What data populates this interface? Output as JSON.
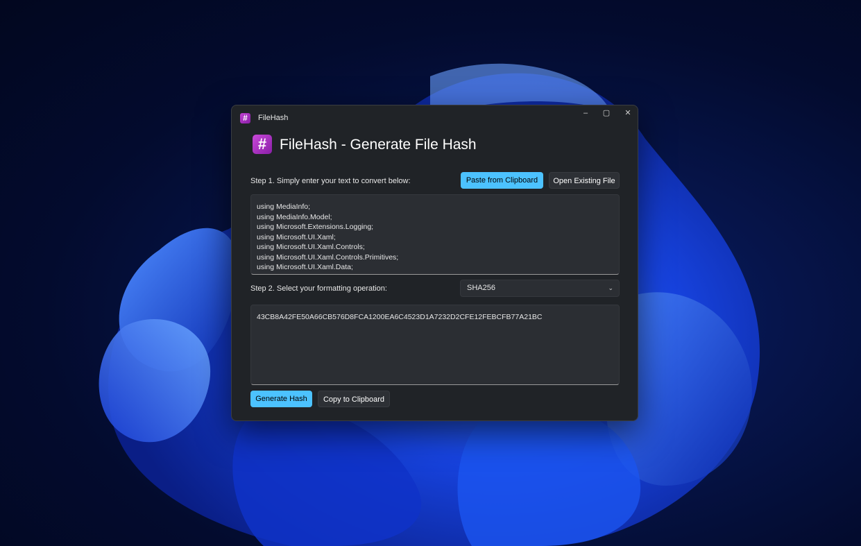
{
  "window": {
    "title": "FileHash",
    "controls": {
      "minimize": "–",
      "maximize": "▢",
      "close": "✕"
    }
  },
  "header": {
    "title": "FileHash - Generate File Hash",
    "icon_glyph": "#"
  },
  "step1": {
    "label": "Step 1. Simply enter your text to convert below:",
    "paste_button": "Paste from Clipboard",
    "open_button": "Open Existing File",
    "input_text": "using MediaInfo;\nusing MediaInfo.Model;\nusing Microsoft.Extensions.Logging;\nusing Microsoft.UI.Xaml;\nusing Microsoft.UI.Xaml.Controls;\nusing Microsoft.UI.Xaml.Controls.Primitives;\nusing Microsoft.UI.Xaml.Data;"
  },
  "step2": {
    "label": "Step 2. Select your formatting operation:",
    "selected_operation": "SHA256",
    "chevron": "⌄"
  },
  "output": {
    "hash": "43CB8A42FE50A66CB576D8FCA1200EA6C4523D1A7232D2CFE12FEBCFB77A21BC"
  },
  "actions": {
    "generate_button": "Generate Hash",
    "copy_button": "Copy to Clipboard"
  },
  "colors": {
    "accent": "#4cc2ff",
    "window_bg": "#202327",
    "app_icon": "#b535c8"
  }
}
